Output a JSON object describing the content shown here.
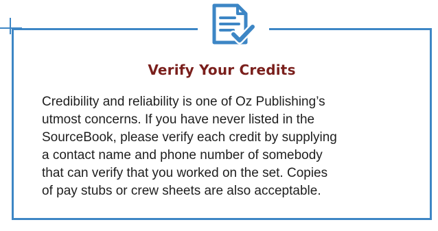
{
  "callout": {
    "icon": "checklist-icon",
    "title": "Verify Your Credits",
    "body_lines": [
      "Credibility and reliability is one of Oz Publishing’s",
      "utmost concerns. If you have never listed in the",
      "SourceBook, please verify each credit by supplying",
      "a contact name and phone number of somebody",
      "that can verify that you worked on the set. Copies",
      "of pay stubs or crew sheets are also acceptable."
    ]
  },
  "colors": {
    "accent": "#3d86c5",
    "title": "#7a1f1c",
    "text": "#1e1e1e"
  }
}
